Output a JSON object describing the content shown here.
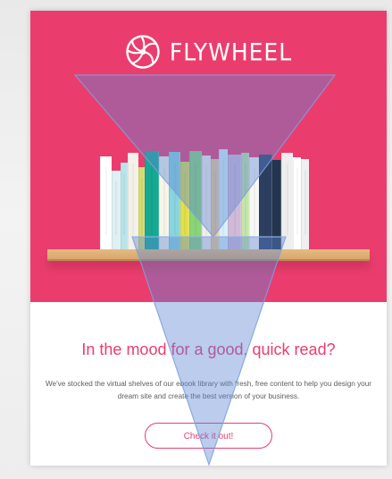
{
  "brand": {
    "name": "FLYWHEEL",
    "icon": "flywheel-logo-icon"
  },
  "hero": {
    "background_color": "#ea3d6e",
    "shelf_color": "#d7a66e",
    "books": [
      {
        "color": "#ffffff",
        "title": ""
      },
      {
        "color": "#dff0f2",
        "title": ""
      },
      {
        "color": "#b8e4ea",
        "title": ""
      },
      {
        "color": "#f3f1e9",
        "title": ""
      },
      {
        "color": "#d7db6e",
        "title": ""
      },
      {
        "color": "#17a892",
        "title": ""
      },
      {
        "color": "#f8f4e8",
        "title": ""
      },
      {
        "color": "#89d4df",
        "title": ""
      },
      {
        "color": "#e3df4a",
        "title": ""
      },
      {
        "color": "#8bd477",
        "title": ""
      },
      {
        "color": "#f1f0ea",
        "title": ""
      },
      {
        "color": "#f0cc91",
        "title": ""
      },
      {
        "color": "#d8f0fa",
        "title": ""
      },
      {
        "color": "#d1b9d8",
        "title": ""
      },
      {
        "color": "#c6e6a9",
        "title": ""
      },
      {
        "color": "#f7f7f7",
        "title": ""
      },
      {
        "color": "#2d3f60",
        "title": ""
      },
      {
        "color": "#24364f",
        "title": ""
      },
      {
        "color": "#eeeeee",
        "title": ""
      },
      {
        "color": "#ffffff",
        "title": ""
      },
      {
        "color": "#ecf0ef",
        "title": ""
      }
    ]
  },
  "content": {
    "headline": "In the mood for a good, quick read?",
    "body": "We've stocked the virtual shelves of our ebook library with fresh, free content to help you design your dream site and create the best version of your business.",
    "cta_label": "Check it out!"
  },
  "overlay": {
    "color": "#5d86d5",
    "opacity": 0.42
  }
}
